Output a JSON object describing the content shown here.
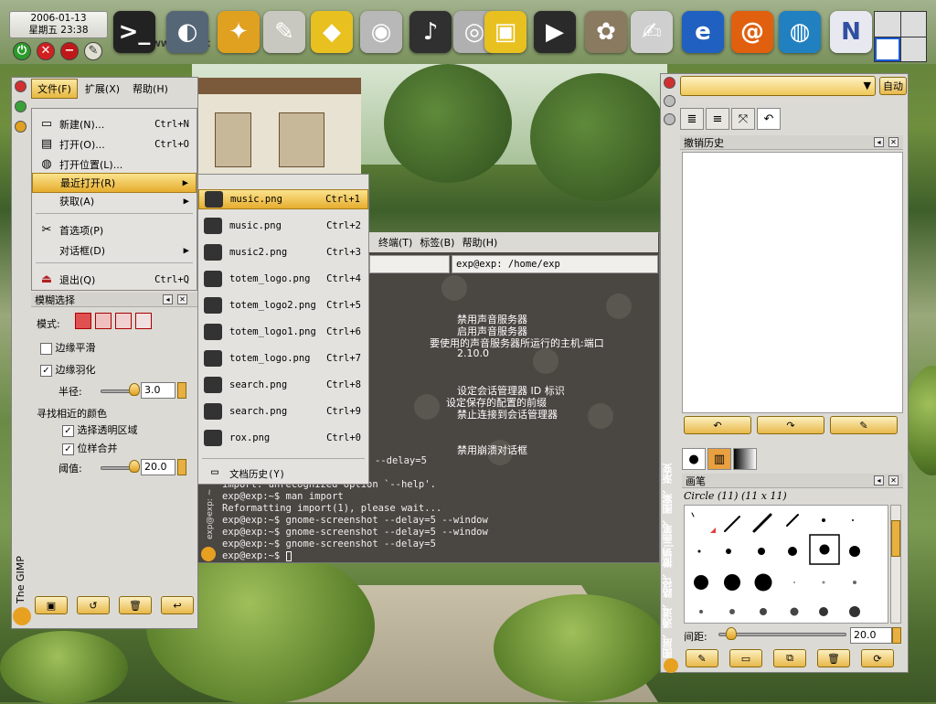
{
  "panel": {
    "date": "2006-01-13",
    "time": "星期五 23:38",
    "watermark": "WWW.COO.C"
  },
  "launchers": [
    {
      "name": "terminal-icon",
      "color": "#222222",
      "glyph": ">_"
    },
    {
      "name": "gaim-icon",
      "color": "#556677",
      "glyph": "◐"
    },
    {
      "name": "gnome-foot-icon",
      "color": "#e0a020",
      "glyph": "✦"
    },
    {
      "name": "text-editor-icon",
      "color": "#c8c8c0",
      "glyph": "✎"
    },
    {
      "name": "car-icon",
      "color": "#e8c020",
      "glyph": "◆"
    },
    {
      "name": "camera-icon",
      "color": "#b8b8b8",
      "glyph": "◉"
    },
    {
      "name": "music-player-icon",
      "color": "#303030",
      "glyph": "♪"
    },
    {
      "name": "speaker-icon",
      "color": "#b0b0b0",
      "glyph": "◎"
    },
    {
      "name": "pack-icon",
      "color": "#e8c020",
      "glyph": "▣"
    },
    {
      "name": "video-icon",
      "color": "#2a2a2a",
      "glyph": "▶"
    },
    {
      "name": "gimp-icon",
      "color": "#8a7a60",
      "glyph": "✿"
    },
    {
      "name": "pen-icon",
      "color": "#cfcfcf",
      "glyph": "✍"
    },
    {
      "name": "browser-e-icon",
      "color": "#2060c0",
      "glyph": "e"
    },
    {
      "name": "swirl-icon",
      "color": "#e06010",
      "glyph": "@"
    },
    {
      "name": "globe-icon",
      "color": "#2080c0",
      "glyph": "◍"
    },
    {
      "name": "network-icon",
      "color": "#e8e8f0",
      "glyph": "N"
    }
  ],
  "gimp": {
    "title": "The GIMP",
    "menubar": [
      "文件(F)",
      "扩展(X)",
      "帮助(H)"
    ],
    "file_menu": [
      {
        "label": "新建(N)...",
        "accel": "Ctrl+N",
        "icon": "new-file-icon",
        "glyph": "▭"
      },
      {
        "label": "打开(O)...",
        "accel": "Ctrl+O",
        "icon": "open-folder-icon",
        "glyph": "▤"
      },
      {
        "label": "打开位置(L)...",
        "accel": "",
        "icon": "globe-location-icon",
        "glyph": "◍"
      },
      {
        "label": "最近打开(R)",
        "accel": "▶",
        "icon": "",
        "glyph": ""
      },
      {
        "label": "获取(A)",
        "accel": "▶",
        "icon": "",
        "glyph": ""
      },
      {
        "label": "首选项(P)",
        "accel": "",
        "icon": "preferences-icon",
        "glyph": "✂"
      },
      {
        "label": "对话框(D)",
        "accel": "▶",
        "icon": "",
        "glyph": ""
      },
      {
        "label": "退出(Q)",
        "accel": "Ctrl+Q",
        "icon": "quit-icon",
        "glyph": "⏏"
      }
    ],
    "recent": [
      {
        "label": "music.png",
        "accel": "Ctrl+1"
      },
      {
        "label": "music.png",
        "accel": "Ctrl+2"
      },
      {
        "label": "music2.png",
        "accel": "Ctrl+3"
      },
      {
        "label": "totem_logo.png",
        "accel": "Ctrl+4"
      },
      {
        "label": "totem_logo2.png",
        "accel": "Ctrl+5"
      },
      {
        "label": "totem_logo1.png",
        "accel": "Ctrl+6"
      },
      {
        "label": "totem_logo.png",
        "accel": "Ctrl+7"
      },
      {
        "label": "search.png",
        "accel": "Ctrl+8"
      },
      {
        "label": "search.png",
        "accel": "Ctrl+9"
      },
      {
        "label": "rox.png",
        "accel": "Ctrl+0"
      }
    ],
    "doc_history": "文档历史(Y)",
    "tool_options": {
      "title": "模糊选择",
      "mode_label": "模式:",
      "antialias": "边缘平滑",
      "feather": "边缘羽化",
      "radius_label": "半径:",
      "radius_value": "3.0",
      "radius_fraction": 0.08,
      "find_similar": "寻找相近的颜色",
      "select_transparent": "选择透明区域",
      "sample_merged": "位样合并",
      "threshold_label": "阈值:",
      "threshold_value": "20.0",
      "threshold_fraction": 0.08
    }
  },
  "terminal": {
    "menubar": [
      "终端(T)",
      "标签(B)",
      "帮助(H)"
    ],
    "tab_title": "exp@exp: /home/exp",
    "side_label": "exp@exp: ~",
    "cn_lines": [
      "禁用声音服务器",
      "启用声音服务器",
      "要使用的声音服务器所运行的主机:端口",
      "2.10.0",
      "设定会话管理器 ID 标识",
      "设定保存的配置的前缀",
      "禁止连接到会话管理器",
      "禁用崩溃对话框"
    ],
    "lines": [
      "--delay=5",
      "import: unrecognized option `--help'.",
      "exp@exp:~$ man import",
      "Reformatting import(1), please wait...",
      "exp@exp:~$ gnome-screenshot --delay=5 --window",
      "exp@exp:~$ gnome-screenshot --delay=5 --window",
      "exp@exp:~$ gnome-screenshot --delay=5",
      "exp@exp:~$ "
    ]
  },
  "dock": {
    "auto_button": "自动",
    "undo_title": "撤销历史",
    "brushes_title": "画笔",
    "brush_name": "Circle (11) (11 x 11)",
    "spacing_label": "间距:",
    "spacing_value": "20.0",
    "spacing_fraction": 0.1,
    "vertical_tabs": "图层、通道、路径、撤销|画笔、图案、渐变"
  }
}
